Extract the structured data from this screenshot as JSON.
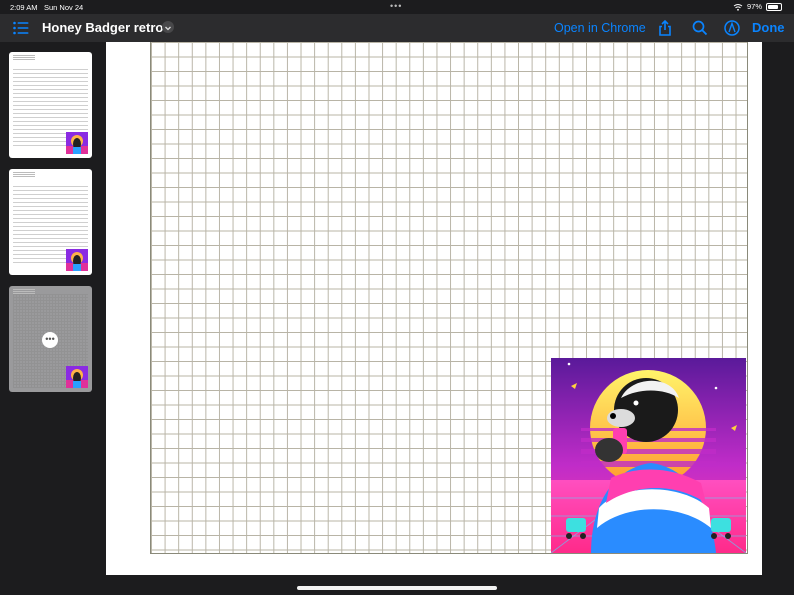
{
  "status": {
    "time": "2:09 AM",
    "date": "Sun Nov 24",
    "battery": "97%"
  },
  "toolbar": {
    "title": "Honey Badger retro",
    "open_chrome": "Open in Chrome",
    "done": "Done"
  },
  "thumbnails": [
    {
      "page": 1,
      "selected": false
    },
    {
      "page": 2,
      "selected": false
    },
    {
      "page": 3,
      "selected": true
    }
  ],
  "colors": {
    "accent": "#0a84ff",
    "toolbar_bg": "#2c2c2e",
    "sidebar_bg": "#1c1c1e"
  },
  "icons": [
    "list-icon",
    "chevron-down-icon",
    "share-icon",
    "search-icon",
    "markup-icon",
    "more-icon",
    "wifi-icon",
    "battery-icon"
  ]
}
